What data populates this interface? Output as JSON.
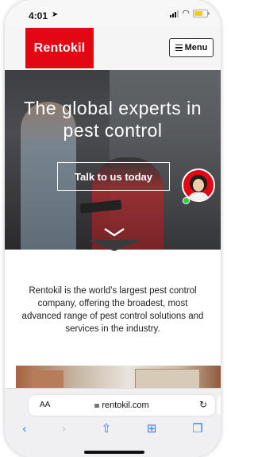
{
  "status_bar": {
    "time": "4:01",
    "location_icon": "location-arrow-icon",
    "signal_icon": "cellular-signal-icon",
    "wifi_icon": "wifi-icon",
    "battery_icon": "battery-icon"
  },
  "header": {
    "logo_text": "Rentokil",
    "menu_label": "Menu",
    "brand_color": "#e30613"
  },
  "hero": {
    "title": "The global experts in pest control",
    "cta_label": "Talk to us today",
    "chat_avatar_icon": "chat-agent-avatar-icon",
    "scroll_icon": "chevron-down-icon"
  },
  "intro": {
    "text": "Rentokil is the world's largest pest control company, offering the broadest, most advanced range of pest control solutions and services in the industry."
  },
  "browser": {
    "text_size_label": "AA",
    "url": "rentokil.com",
    "toolbar": {
      "back_icon": "back-icon",
      "forward_icon": "forward-icon",
      "share_icon": "share-icon",
      "bookmarks_icon": "bookmarks-icon",
      "tabs_icon": "tabs-icon"
    }
  }
}
